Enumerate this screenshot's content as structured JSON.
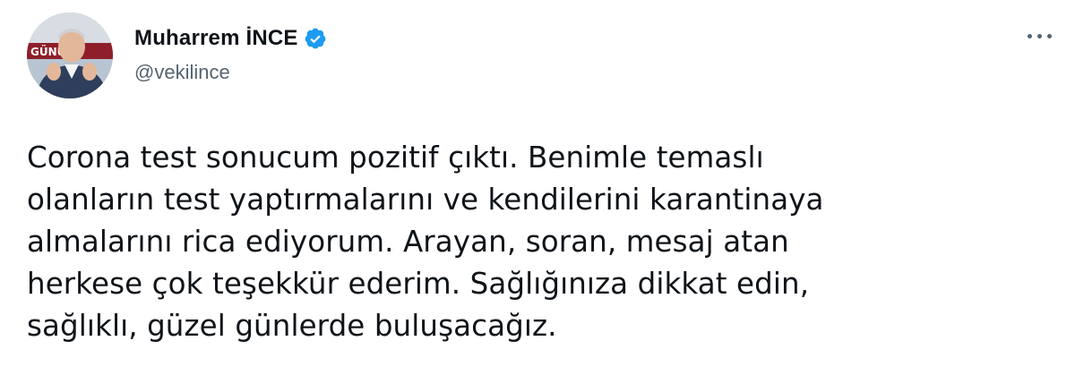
{
  "author": {
    "display_name": "Muharrem İNCE",
    "handle": "@vekilince",
    "verified": true,
    "avatar_banner_text": "GÜNÜ",
    "verified_color": "#1d9bf0"
  },
  "menu": {
    "icon": "more-horizontal-icon"
  },
  "tweet": {
    "lines": [
      "Corona test sonucum pozitif çıktı. Benimle temaslı",
      "olanların test yaptırmalarını ve kendilerini karantinaya",
      "almalarını rica ediyorum. Arayan, soran, mesaj atan",
      "herkese çok teşekkür ederim. Sağlığınıza dikkat edin,",
      "sağlıklı, güzel günlerde buluşacağız."
    ]
  }
}
